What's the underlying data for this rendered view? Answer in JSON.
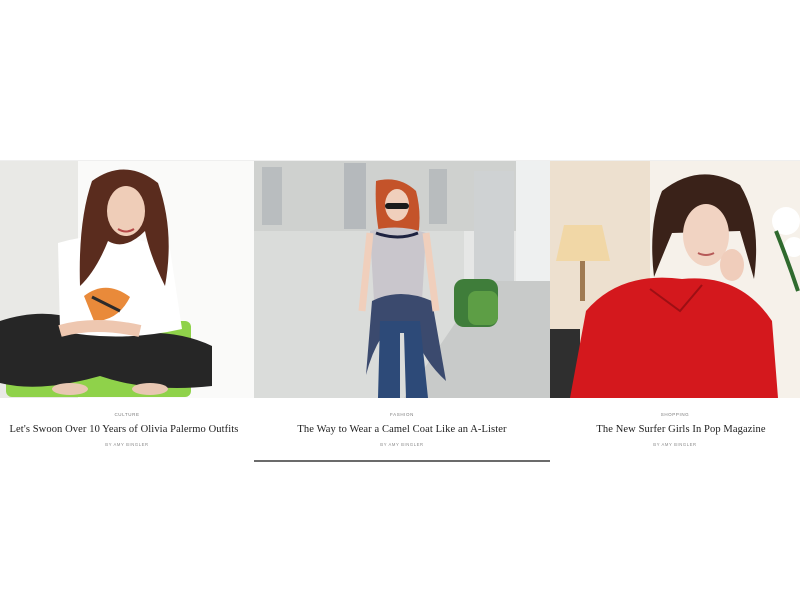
{
  "cards": [
    {
      "category": "Culture",
      "title": "Let's Swoon Over 10 Years of Olivia Palermo Outfits",
      "byline": "By Amy Bingler",
      "image": "woman-white-tee-green-chair-photo"
    },
    {
      "category": "Fashion",
      "title": "The Way to Wear a Camel Coat Like an A-Lister",
      "byline": "By Amy Bingler",
      "image": "redhead-grey-tee-plaid-shirt-street-photo"
    },
    {
      "category": "Shopping",
      "title": "The New Surfer Girls In Pop Magazine",
      "byline": "By Amy Bingler",
      "image": "woman-red-blouse-lamp-photo"
    }
  ],
  "colors": {
    "background": "#ffffff",
    "title_text": "#1c1c1c",
    "meta_text": "#7a7a7a",
    "active_underline": "#6b6b6b"
  }
}
